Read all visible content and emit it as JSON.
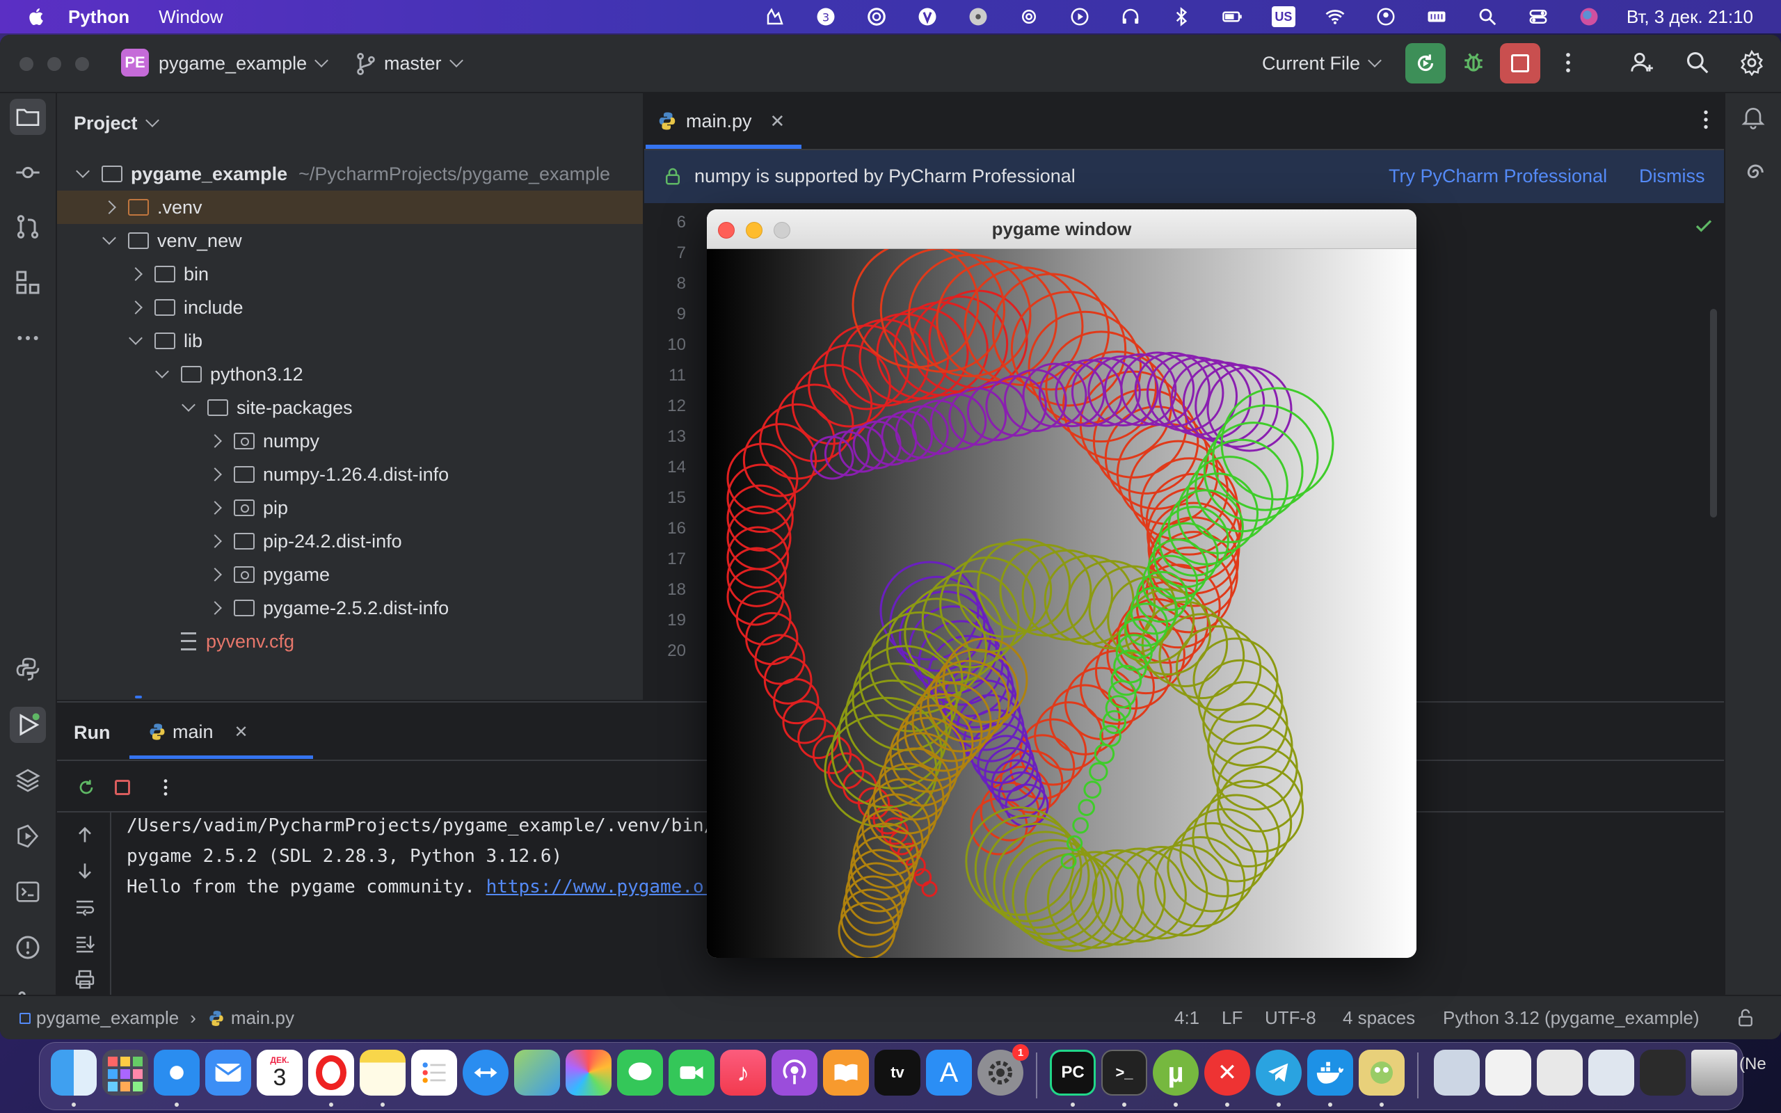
{
  "menubar": {
    "app_name": "Python",
    "menu_items": [
      "Window"
    ],
    "input_source": "US",
    "clock": "Вт, 3 дек.  21:10"
  },
  "titlebar": {
    "project_badge": "PE",
    "project_name": "pygame_example",
    "branch": "master",
    "run_config": "Current File"
  },
  "project_panel": {
    "title": "Project",
    "root_name": "pygame_example",
    "root_path": "~/PycharmProjects/pygame_example",
    "items": [
      {
        "label": ".venv",
        "level": 1,
        "expanded": false,
        "kind": "folder-orange"
      },
      {
        "label": "venv_new",
        "level": 1,
        "expanded": true,
        "kind": "folder"
      },
      {
        "label": "bin",
        "level": 2,
        "expanded": false,
        "kind": "folder"
      },
      {
        "label": "include",
        "level": 2,
        "expanded": false,
        "kind": "folder"
      },
      {
        "label": "lib",
        "level": 2,
        "expanded": true,
        "kind": "folder"
      },
      {
        "label": "python3.12",
        "level": 3,
        "expanded": true,
        "kind": "folder"
      },
      {
        "label": "site-packages",
        "level": 4,
        "expanded": true,
        "kind": "folder"
      },
      {
        "label": "numpy",
        "level": 5,
        "expanded": false,
        "kind": "package"
      },
      {
        "label": "numpy-1.26.4.dist-info",
        "level": 5,
        "expanded": false,
        "kind": "folder"
      },
      {
        "label": "pip",
        "level": 5,
        "expanded": false,
        "kind": "package"
      },
      {
        "label": "pip-24.2.dist-info",
        "level": 5,
        "expanded": false,
        "kind": "folder"
      },
      {
        "label": "pygame",
        "level": 5,
        "expanded": false,
        "kind": "package"
      },
      {
        "label": "pygame-2.5.2.dist-info",
        "level": 5,
        "expanded": false,
        "kind": "folder"
      },
      {
        "label": "pyvenv.cfg",
        "level": 3,
        "expanded": null,
        "kind": "file"
      }
    ]
  },
  "editor": {
    "tab_label": "main.py",
    "banner_text": "numpy is supported by PyCharm Professional",
    "banner_action": "Try PyCharm Professional",
    "banner_dismiss": "Dismiss",
    "line_numbers": [
      "6",
      "7",
      "8",
      "9",
      "10",
      "11",
      "12",
      "13",
      "14",
      "15",
      "16",
      "17",
      "18",
      "19",
      "20"
    ]
  },
  "pygame_window": {
    "title": "pygame window"
  },
  "run_panel": {
    "title": "Run",
    "tab_label": "main",
    "console_lines": [
      "/Users/vadim/PycharmProjects/pygame_example/.venv/bin/",
      "pygame 2.5.2 (SDL 2.28.3, Python 3.12.6)",
      "Hello from the pygame community. "
    ],
    "console_link": "https://www.pygame.or"
  },
  "statusbar": {
    "breadcrumb_project": "pygame_example",
    "breadcrumb_file": "main.py",
    "position": "4:1",
    "line_sep": "LF",
    "encoding": "UTF-8",
    "indent": "4 spaces",
    "interpreter": "Python 3.12 (pygame_example)"
  },
  "dock": {
    "calendar_month": "ДЕК.",
    "calendar_day": "3",
    "settings_badge": "1",
    "pycharm_label": "PC",
    "right_edge_text": "(Ne"
  },
  "colors": {
    "accent": "#3574f0",
    "run_green": "#3d8f58",
    "stop_red": "#c94f4f",
    "selection": "#43382a"
  }
}
